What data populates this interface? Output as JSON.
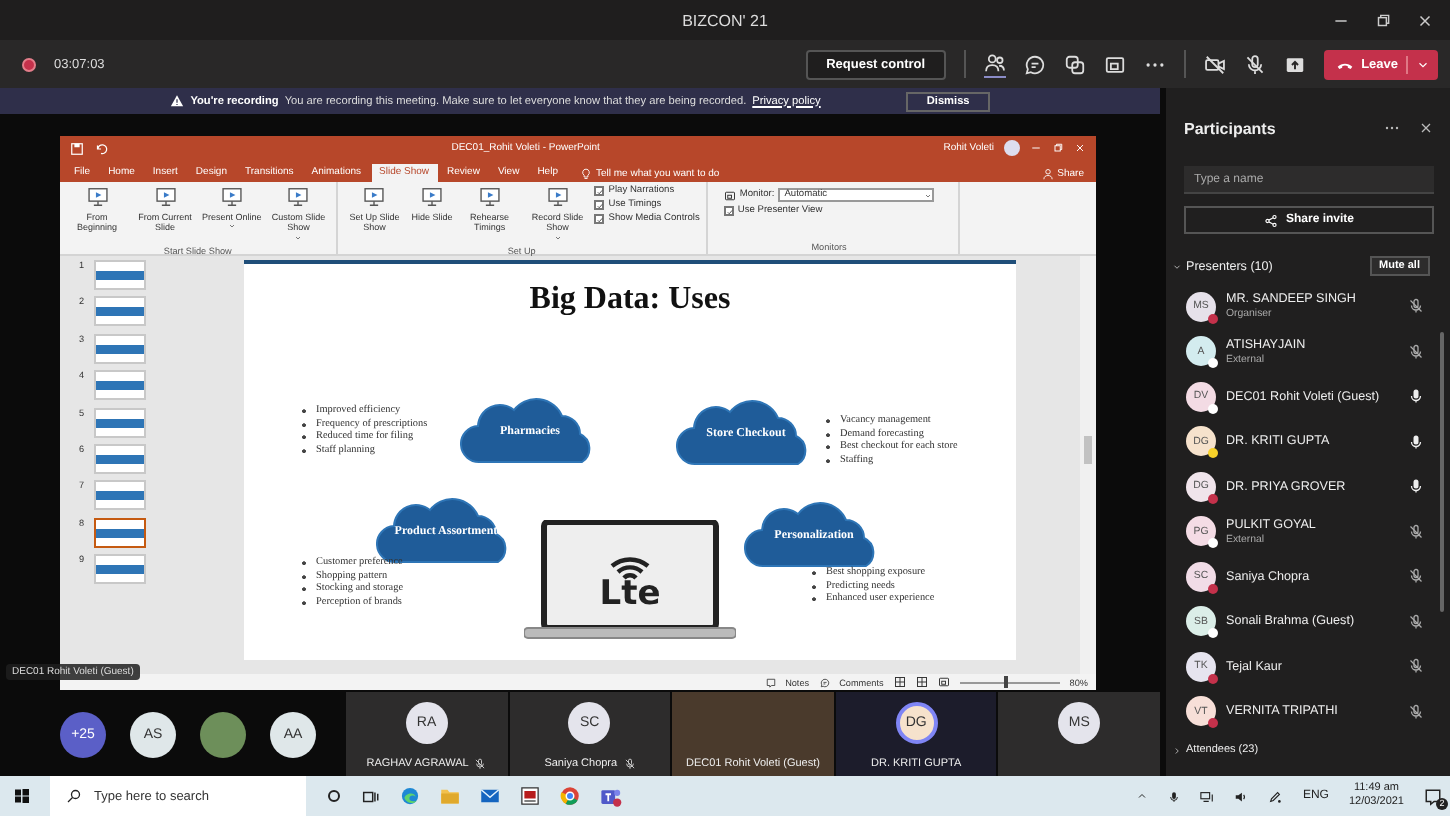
{
  "window": {
    "title": "BIZCON' 21"
  },
  "meeting_bar": {
    "recording": true,
    "timer": "03:07:03",
    "request_control": "Request control",
    "leave": "Leave"
  },
  "banner": {
    "heading": "You're recording",
    "message": "You are recording this meeting. Make sure to let everyone know that they are being recorded.",
    "link": "Privacy policy",
    "dismiss": "Dismiss"
  },
  "powerpoint": {
    "title": "DEC01_Rohit Voleti - PowerPoint",
    "user": "Rohit Voleti",
    "tell_me": "Tell me what you want to do",
    "share": "Share",
    "tabs": [
      {
        "label": "File",
        "selected": false
      },
      {
        "label": "Home",
        "selected": false
      },
      {
        "label": "Insert",
        "selected": false
      },
      {
        "label": "Design",
        "selected": false
      },
      {
        "label": "Transitions",
        "selected": false
      },
      {
        "label": "Animations",
        "selected": false
      },
      {
        "label": "Slide Show",
        "selected": true
      },
      {
        "label": "Review",
        "selected": false
      },
      {
        "label": "View",
        "selected": false
      },
      {
        "label": "Help",
        "selected": false
      }
    ],
    "ribbon": [
      {
        "label": "Start Slide Show",
        "buttons": [
          {
            "label": "From Beginning",
            "menu": false
          },
          {
            "label": "From Current Slide",
            "menu": false
          },
          {
            "label": "Present Online",
            "menu": true
          },
          {
            "label": "Custom Slide Show",
            "menu": true
          }
        ]
      },
      {
        "label": "Set Up",
        "buttons": [
          {
            "label": "Set Up Slide Show",
            "menu": false
          },
          {
            "label": "Hide Slide",
            "menu": false
          },
          {
            "label": "Rehearse Timings",
            "menu": false
          },
          {
            "label": "Record Slide Show",
            "menu": true
          }
        ],
        "checkboxes": [
          {
            "label": "Play Narrations",
            "checked": true
          },
          {
            "label": "Use Timings",
            "checked": true
          },
          {
            "label": "Show Media Controls",
            "checked": true
          }
        ]
      },
      {
        "label": "Monitors",
        "monitor": {
          "label": "Monitor:",
          "value": "Automatic"
        },
        "checkboxes": [
          {
            "label": "Use Presenter View",
            "checked": true
          }
        ]
      }
    ],
    "slides": [
      {
        "number": "1",
        "selected": false
      },
      {
        "number": "2",
        "selected": false
      },
      {
        "number": "3",
        "selected": false
      },
      {
        "number": "4",
        "selected": false
      },
      {
        "number": "5",
        "selected": false
      },
      {
        "number": "6",
        "selected": false
      },
      {
        "number": "7",
        "selected": false
      },
      {
        "number": "8",
        "selected": true
      },
      {
        "number": "9",
        "selected": false
      }
    ],
    "slide": {
      "title": "Big Data: Uses",
      "logo": "Lte",
      "topics": [
        {
          "label": "Pharmacies",
          "bullets": [
            "Improved efficiency",
            "Frequency of prescriptions",
            "Reduced time for filing",
            "Staff planning"
          ]
        },
        {
          "label": "Store Checkout",
          "bullets": [
            "Vacancy management",
            "Demand forecasting",
            "Best checkout for each store",
            "Staffing"
          ]
        },
        {
          "label": "Product Assortment",
          "bullets": [
            "Customer preference",
            "Shopping pattern",
            "Stocking and storage",
            "Perception of brands"
          ]
        },
        {
          "label": "Personalization",
          "bullets": [
            "Best shopping exposure",
            "Predicting needs",
            "Enhanced user experience"
          ]
        }
      ]
    },
    "status_bar": {
      "notes": "Notes",
      "comments": "Comments",
      "zoom": {
        "label": "80%",
        "level": 0.45
      }
    }
  },
  "presenter_label": "DEC01 Rohit Voleti (Guest)",
  "video_strip": {
    "overflow": "+25",
    "avatars": [
      {
        "kind": "initials",
        "initials": "AS"
      },
      {
        "kind": "photo"
      },
      {
        "kind": "initials",
        "initials": "AA"
      }
    ],
    "tiles": [
      {
        "kind": "avatar",
        "initials": "RA",
        "name": "RAGHAV AGRAWAL",
        "muted": true,
        "speaking": false
      },
      {
        "kind": "avatar",
        "initials": "SC",
        "name": "Saniya Chopra",
        "muted": true,
        "speaking": false
      },
      {
        "kind": "video",
        "name": "DEC01 Rohit Voleti (Guest)",
        "muted": false
      },
      {
        "kind": "avatar",
        "initials": "DG",
        "name": "DR. KRITI GUPTA",
        "muted": false,
        "speaking": true
      },
      {
        "kind": "avatar",
        "initials": "MS",
        "muted": false,
        "speaking": false
      }
    ]
  },
  "participants": {
    "title": "Participants",
    "search": {
      "placeholder": "Type a name"
    },
    "share_invite": "Share invite",
    "presenters": "Presenters (10)",
    "mute_all": "Mute all",
    "attendees": "Attendees (23)",
    "people": [
      {
        "avatar": {
          "initials": "MS",
          "color": "#e6e1ea"
        },
        "status": {
          "color": "#c4314b"
        },
        "name": "MR. SANDEEP SINGH",
        "role": "Organiser",
        "muted": true
      },
      {
        "avatar": {
          "initials": "A",
          "color": "#d3ecef"
        },
        "status": {
          "color": "#ffffff"
        },
        "name": "ATISHAYJAIN",
        "role": "External",
        "muted": true
      },
      {
        "avatar": {
          "initials": "DV",
          "color": "#f3dbe4"
        },
        "status": {
          "color": "#ffffff"
        },
        "name": "DEC01 Rohit Voleti (Guest)",
        "muted": false
      },
      {
        "avatar": {
          "initials": "DG",
          "color": "#f6e2cc"
        },
        "status": {
          "color": "#f8d22a"
        },
        "name": "DR. KRITI GUPTA",
        "muted": false
      },
      {
        "avatar": {
          "initials": "DG",
          "color": "#f0e4eb"
        },
        "status": {
          "color": "#c4314b"
        },
        "name": "DR. PRIYA GROVER",
        "muted": false
      },
      {
        "avatar": {
          "initials": "PG",
          "color": "#f4dce5"
        },
        "status": {
          "color": "#ffffff"
        },
        "name": "PULKIT GOYAL",
        "role": "External",
        "muted": true
      },
      {
        "avatar": {
          "initials": "SC",
          "color": "#f1dce7"
        },
        "status": {
          "color": "#c4314b"
        },
        "name": "Saniya Chopra",
        "muted": true
      },
      {
        "avatar": {
          "initials": "SB",
          "color": "#dbeee8"
        },
        "status": {
          "color": "#ffffff"
        },
        "name": "Sonali Brahma (Guest)",
        "muted": true
      },
      {
        "avatar": {
          "initials": "TK",
          "color": "#e6e4ef"
        },
        "status": {
          "color": "#c4314b"
        },
        "name": "Tejal Kaur",
        "muted": true
      },
      {
        "avatar": {
          "initials": "VT",
          "color": "#f7dfd8"
        },
        "status": {
          "color": "#c4314b"
        },
        "name": "VERNITA TRIPATHI",
        "muted": true
      }
    ]
  },
  "taskbar": {
    "search": {
      "placeholder": "Type here to search"
    },
    "language": "ENG",
    "time": "11:49 am",
    "date": "12/03/2021",
    "notifications": "2"
  }
}
